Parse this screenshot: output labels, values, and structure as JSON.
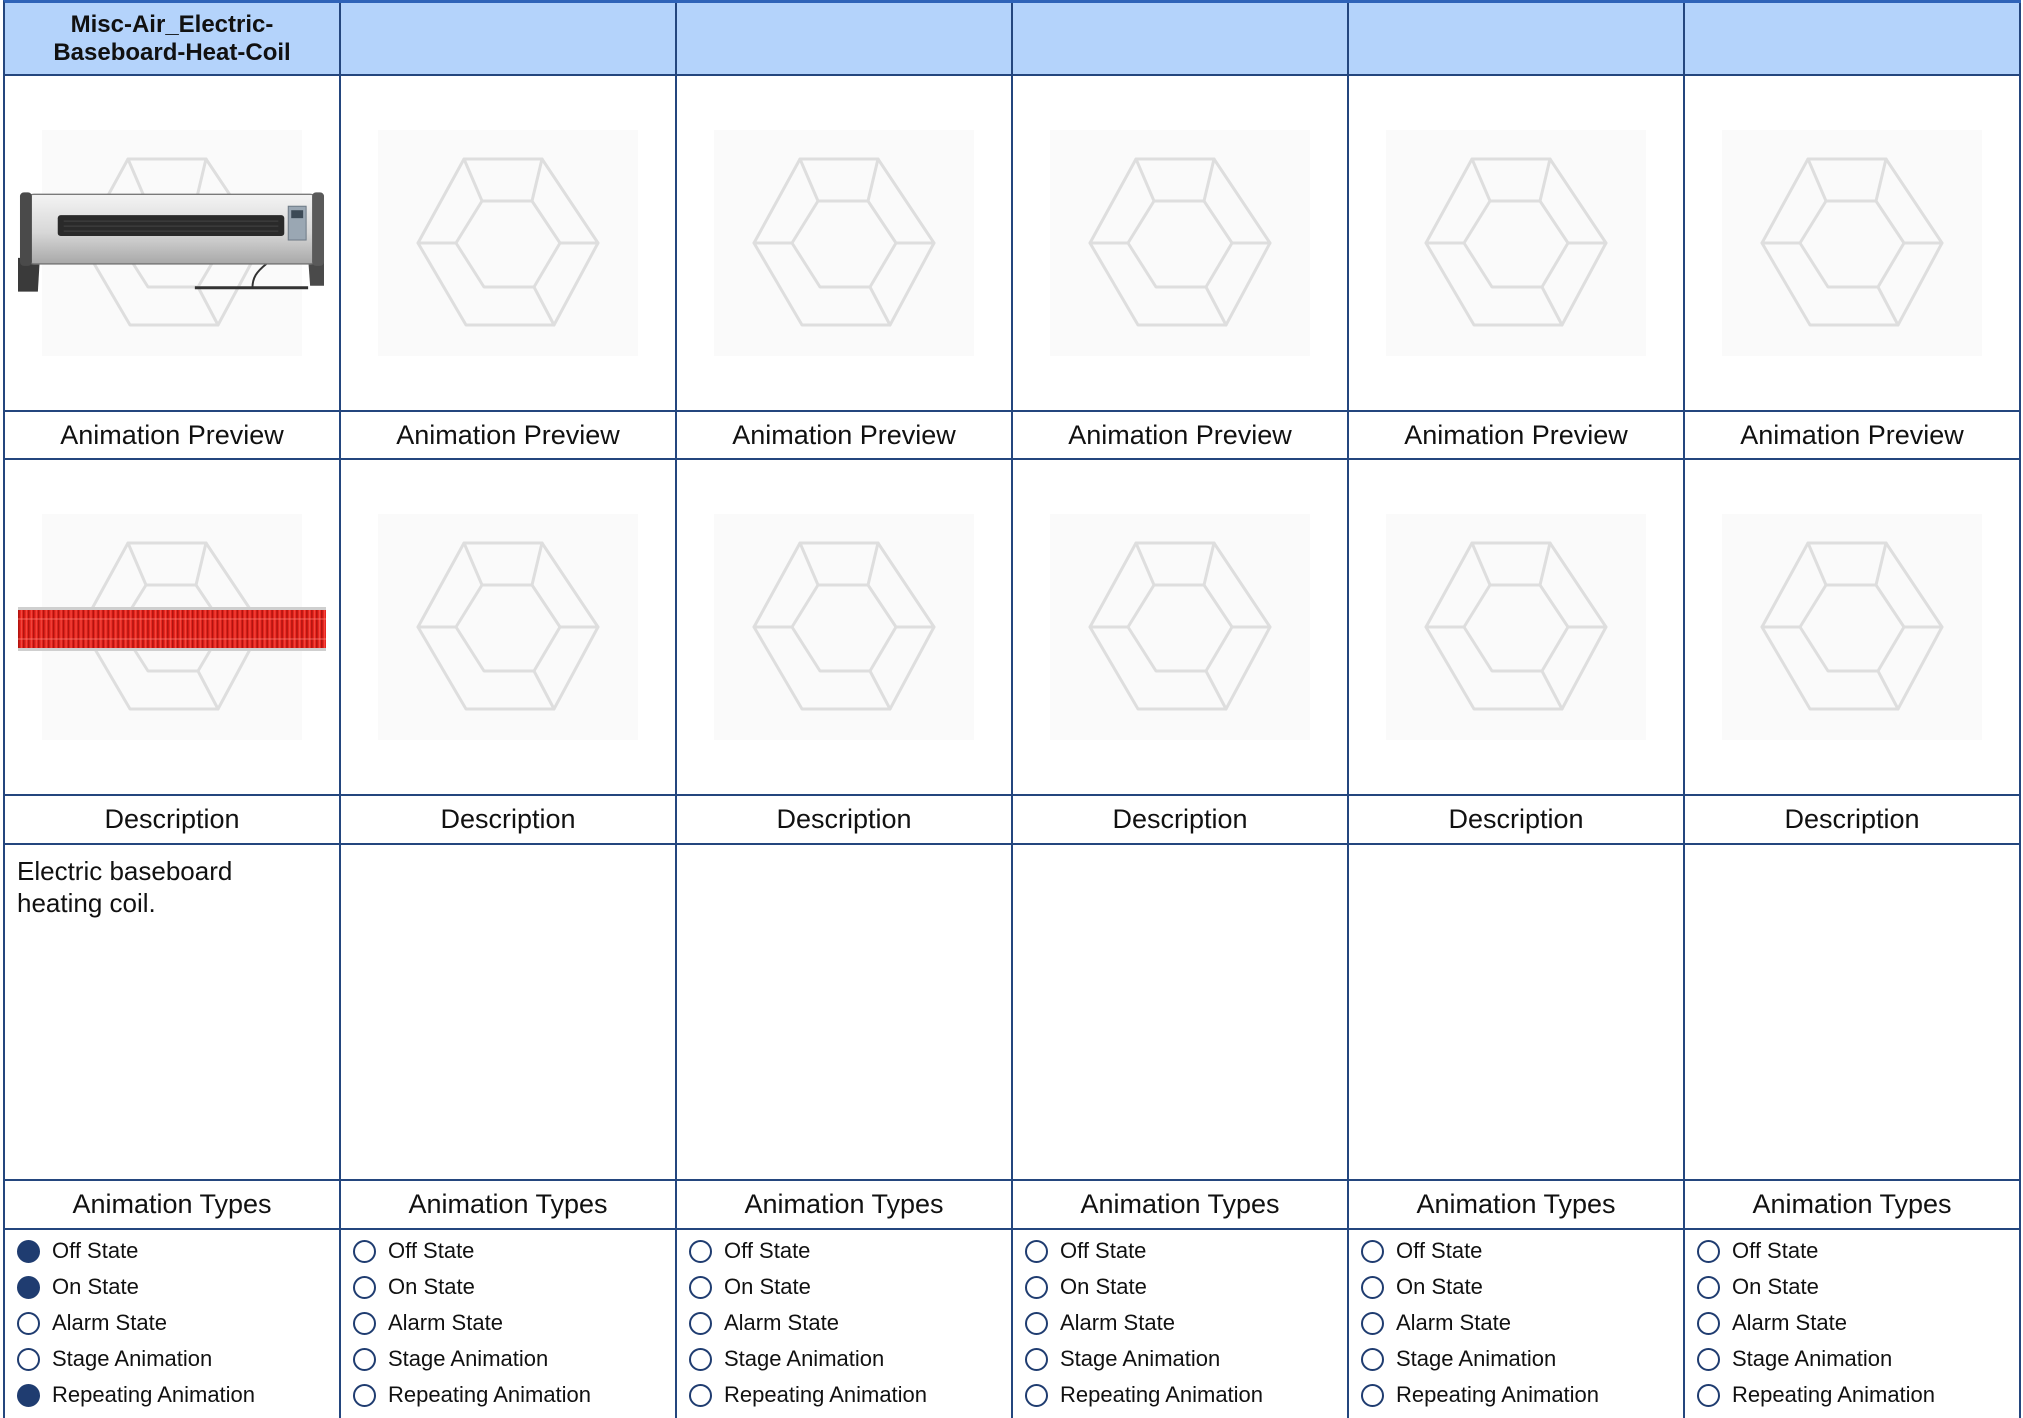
{
  "colors": {
    "grid_border": "#24467e",
    "top_border": "#2f63b8",
    "header_background": "#b4d3fb",
    "radio_selected": "#1f3c70",
    "coil_red": "#e8261f"
  },
  "columns": [
    {
      "title": "Misc-Air_Electric-Baseboard-Heat-Coil",
      "image_top": "electric-baseboard-heater-image",
      "preview_label": "Animation Preview",
      "image_preview": "red-heat-coil-image",
      "description_label": "Description",
      "description": "Electric baseboard heating coil.",
      "types_label": "Animation Types",
      "types": [
        {
          "label": "Off State",
          "selected": true
        },
        {
          "label": "On State",
          "selected": true
        },
        {
          "label": "Alarm State",
          "selected": false
        },
        {
          "label": "Stage Animation",
          "selected": false
        },
        {
          "label": "Repeating Animation",
          "selected": true
        }
      ]
    },
    {
      "title": "",
      "image_top": "placeholder-logo-image",
      "preview_label": "Animation Preview",
      "image_preview": "placeholder-logo-image",
      "description_label": "Description",
      "description": "",
      "types_label": "Animation Types",
      "types": [
        {
          "label": "Off State",
          "selected": false
        },
        {
          "label": "On State",
          "selected": false
        },
        {
          "label": "Alarm State",
          "selected": false
        },
        {
          "label": "Stage Animation",
          "selected": false
        },
        {
          "label": "Repeating Animation",
          "selected": false
        }
      ]
    },
    {
      "title": "",
      "image_top": "placeholder-logo-image",
      "preview_label": "Animation Preview",
      "image_preview": "placeholder-logo-image",
      "description_label": "Description",
      "description": "",
      "types_label": "Animation Types",
      "types": [
        {
          "label": "Off State",
          "selected": false
        },
        {
          "label": "On State",
          "selected": false
        },
        {
          "label": "Alarm State",
          "selected": false
        },
        {
          "label": "Stage Animation",
          "selected": false
        },
        {
          "label": "Repeating Animation",
          "selected": false
        }
      ]
    },
    {
      "title": "",
      "image_top": "placeholder-logo-image",
      "preview_label": "Animation Preview",
      "image_preview": "placeholder-logo-image",
      "description_label": "Description",
      "description": "",
      "types_label": "Animation Types",
      "types": [
        {
          "label": "Off State",
          "selected": false
        },
        {
          "label": "On State",
          "selected": false
        },
        {
          "label": "Alarm State",
          "selected": false
        },
        {
          "label": "Stage Animation",
          "selected": false
        },
        {
          "label": "Repeating Animation",
          "selected": false
        }
      ]
    },
    {
      "title": "",
      "image_top": "placeholder-logo-image",
      "preview_label": "Animation Preview",
      "image_preview": "placeholder-logo-image",
      "description_label": "Description",
      "description": "",
      "types_label": "Animation Types",
      "types": [
        {
          "label": "Off State",
          "selected": false
        },
        {
          "label": "On State",
          "selected": false
        },
        {
          "label": "Alarm State",
          "selected": false
        },
        {
          "label": "Stage Animation",
          "selected": false
        },
        {
          "label": "Repeating Animation",
          "selected": false
        }
      ]
    },
    {
      "title": "",
      "image_top": "placeholder-logo-image",
      "preview_label": "Animation Preview",
      "image_preview": "placeholder-logo-image",
      "description_label": "Description",
      "description": "",
      "types_label": "Animation Types",
      "types": [
        {
          "label": "Off State",
          "selected": false
        },
        {
          "label": "On State",
          "selected": false
        },
        {
          "label": "Alarm State",
          "selected": false
        },
        {
          "label": "Stage Animation",
          "selected": false
        },
        {
          "label": "Repeating Animation",
          "selected": false
        }
      ]
    }
  ]
}
